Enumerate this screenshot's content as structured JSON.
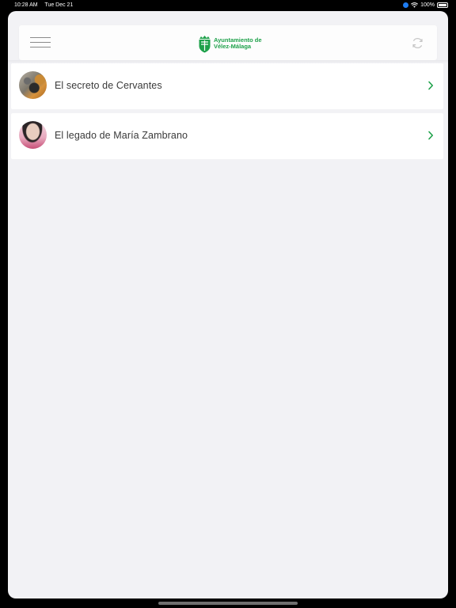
{
  "status_bar": {
    "time": "10:28 AM",
    "date": "Tue Dec 21",
    "battery": "100%"
  },
  "header": {
    "logo_line1": "Ayuntamiento de",
    "logo_line2": "Vélez-Málaga",
    "brand_color": "#1ea14a"
  },
  "list": {
    "items": [
      {
        "label": "El secreto de Cervantes",
        "icon": "chevron-right-icon"
      },
      {
        "label": "El legado de María Zambrano",
        "icon": "chevron-right-icon"
      }
    ]
  }
}
